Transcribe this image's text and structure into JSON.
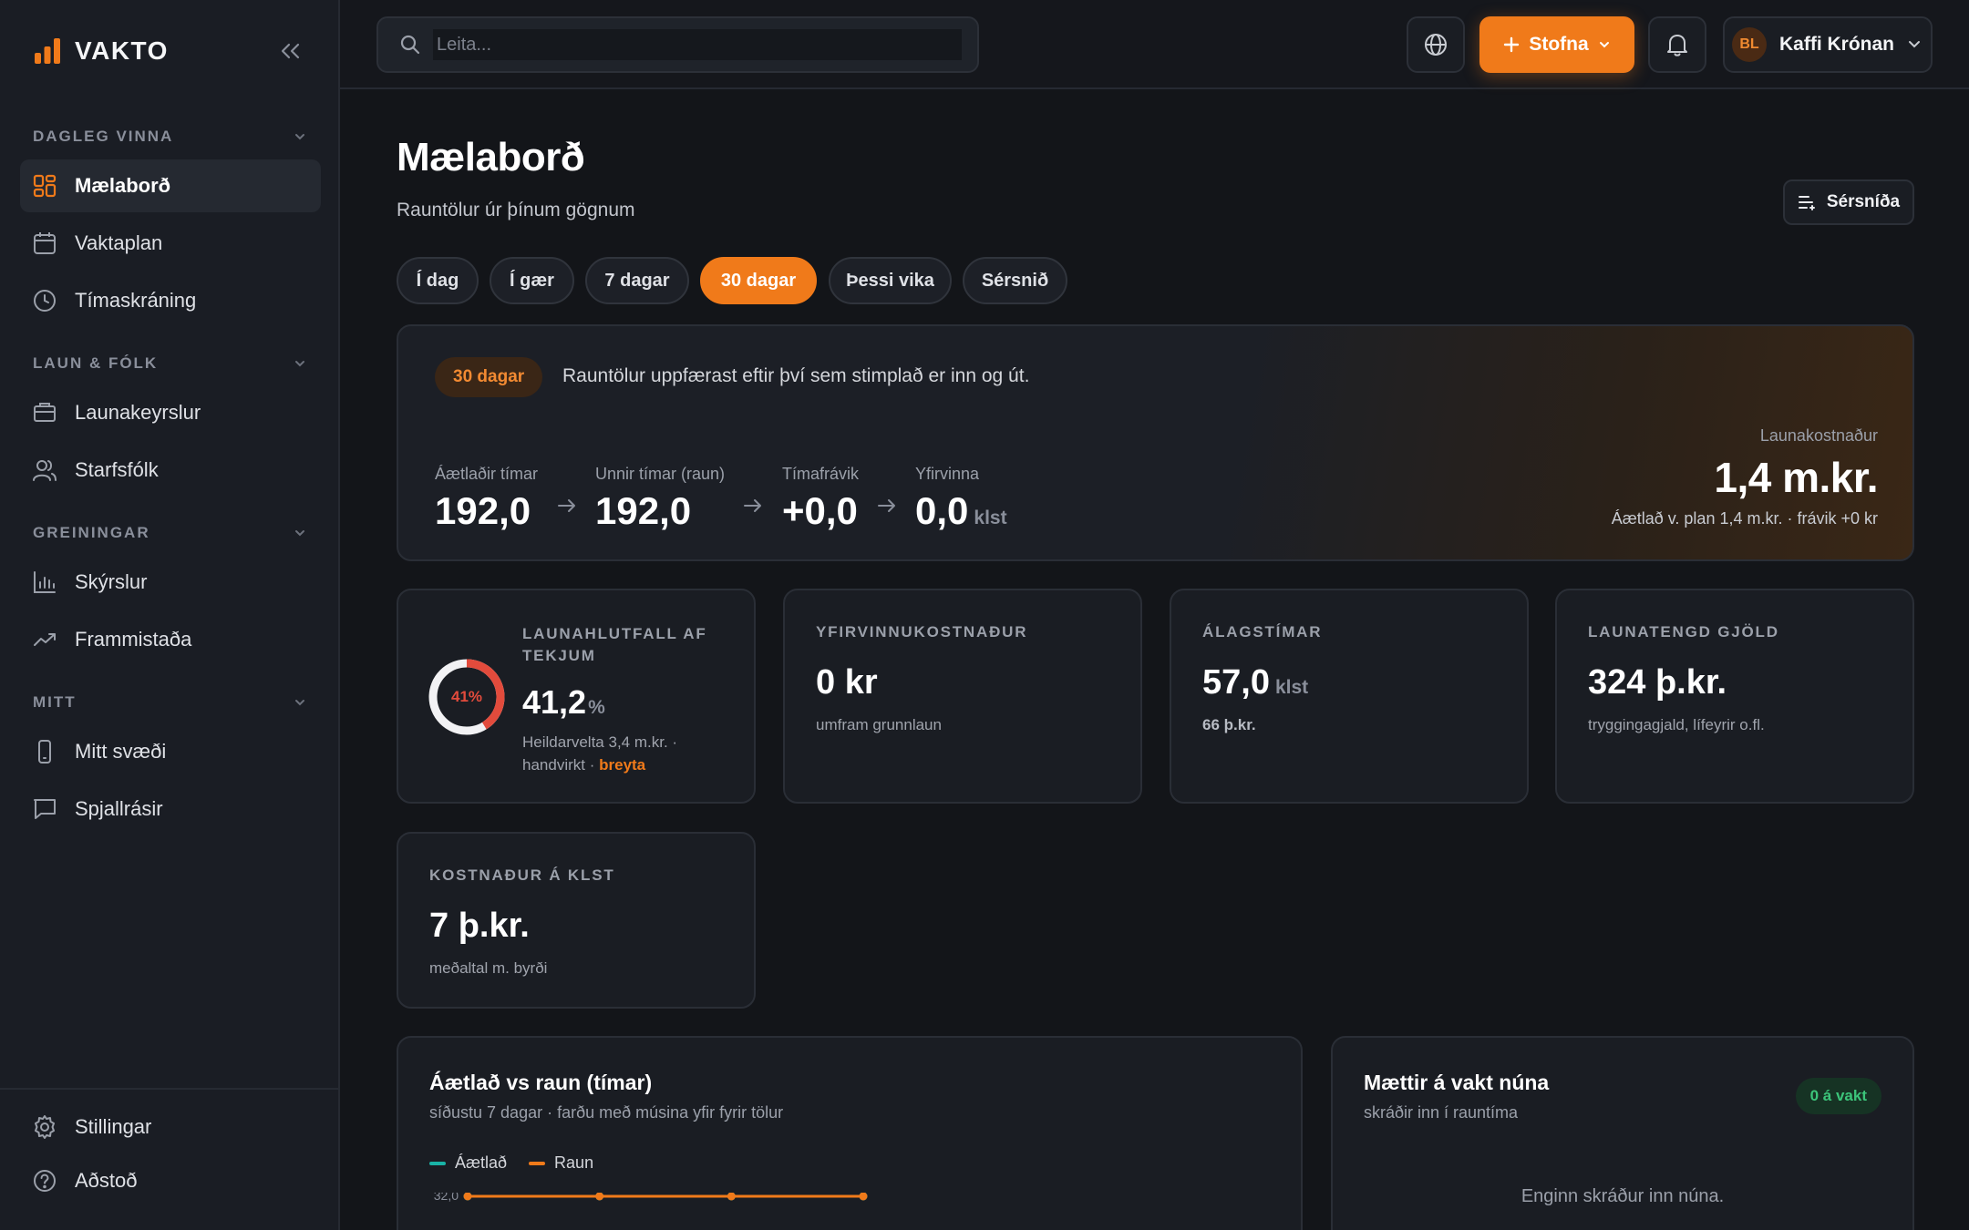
{
  "brand": {
    "name": "VAKTO"
  },
  "colors": {
    "accent": "#f07a1a",
    "danger": "#e24b3c",
    "teal": "#19b3a6",
    "success": "#3cc57a"
  },
  "sidebar": {
    "sections": [
      {
        "label": "DAGLEG VINNA",
        "items": [
          {
            "label": "Mælaborð",
            "icon": "grid-icon"
          },
          {
            "label": "Vaktaplan",
            "icon": "calendar-icon"
          },
          {
            "label": "Tímaskráning",
            "icon": "clock-icon"
          }
        ]
      },
      {
        "label": "LAUN & FÓLK",
        "items": [
          {
            "label": "Launakeyrslur",
            "icon": "wallet-icon"
          },
          {
            "label": "Starfsfólk",
            "icon": "users-icon"
          }
        ]
      },
      {
        "label": "GREININGAR",
        "items": [
          {
            "label": "Skýrslur",
            "icon": "bar-chart-icon"
          },
          {
            "label": "Frammistaða",
            "icon": "trend-icon"
          }
        ]
      },
      {
        "label": "MITT",
        "items": [
          {
            "label": "Mitt svæði",
            "icon": "phone-icon"
          },
          {
            "label": "Spjallrásir",
            "icon": "chat-icon"
          }
        ]
      }
    ],
    "footer": [
      {
        "label": "Stillingar",
        "icon": "gear-icon"
      },
      {
        "label": "Aðstoð",
        "icon": "help-icon"
      }
    ]
  },
  "topbar": {
    "search_placeholder": "Leita...",
    "create_label": "Stofna",
    "user": {
      "initials": "BL",
      "name": "Kaffi Krónan"
    }
  },
  "page": {
    "title": "Mælaborð",
    "subtitle": "Rauntölur úr þínum gögnum",
    "customize_label": "Sérsníða",
    "chips": [
      "Í dag",
      "Í gær",
      "7 dagar",
      "30 dagar",
      "Þessi vika",
      "Sérsnið"
    ],
    "active_chip": "30 dagar"
  },
  "hero": {
    "badge": "30 dagar",
    "note": "Rauntölur uppfærast eftir því sem stimplað er inn og út.",
    "metrics": [
      {
        "label": "Áætlaðir tímar",
        "value": "192,0",
        "unit": ""
      },
      {
        "label": "Unnir tímar (raun)",
        "value": "192,0",
        "unit": ""
      },
      {
        "label": "Tímafrávik",
        "value": "+0,0",
        "unit": ""
      },
      {
        "label": "Yfirvinna",
        "value": "0,0",
        "unit": "klst"
      }
    ],
    "cost_label": "Launakostnaður",
    "cost_value": "1,4 m.kr.",
    "cost_sub": "Áætlað v. plan 1,4 m.kr. · frávik +0 kr"
  },
  "cards": {
    "ratio": {
      "label_line1": "LAUNAHLUTFALL AF",
      "label_line2": "TEKJUM",
      "donut_text": "41%",
      "value": "41,2",
      "unit": "%",
      "percent": 41.2,
      "sub_line1": "Heildarvelta 3,4 m.kr. ·",
      "sub_line2": "handvirkt ·",
      "link": "breyta"
    },
    "overtime": {
      "label": "YFIRVINNUKOSTNAÐUR",
      "value": "0 kr",
      "sub": "umfram grunnlaun"
    },
    "surcharge": {
      "label": "ÁLAGSTÍMAR",
      "value": "57,0",
      "unit": "klst",
      "sub": "66 þ.kr."
    },
    "payroll": {
      "label": "LAUNATENGD GJÖLD",
      "value": "324 þ.kr.",
      "sub": "tryggingagjald, lífeyrir o.fl."
    },
    "hourly": {
      "label": "KOSTNAÐUR Á KLST",
      "value": "7 þ.kr.",
      "sub": "meðaltal m. byrði"
    }
  },
  "chart_panel": {
    "title": "Áætlað vs raun (tímar)",
    "subtitle": "síðustu 7 dagar · farðu með músina yfir fyrir tölur",
    "legend": [
      "Áætlað",
      "Raun"
    ],
    "y_tick": "32,0"
  },
  "chart_data": {
    "type": "line",
    "title": "Áætlað vs raun (tímar)",
    "xlabel": "",
    "ylabel": "",
    "series": [
      {
        "name": "Áætlað",
        "color": "#19b3a6",
        "values": [
          32,
          32,
          32,
          32
        ]
      },
      {
        "name": "Raun",
        "color": "#f07a1a",
        "values": [
          32,
          32,
          32,
          32
        ]
      }
    ],
    "y_ticks": [
      "32,0"
    ],
    "legend_position": "top-left"
  },
  "onshift_panel": {
    "title": "Mættir á vakt núna",
    "subtitle": "skráðir inn í rauntíma",
    "badge": "0 á vakt",
    "empty": "Enginn skráður inn núna."
  }
}
